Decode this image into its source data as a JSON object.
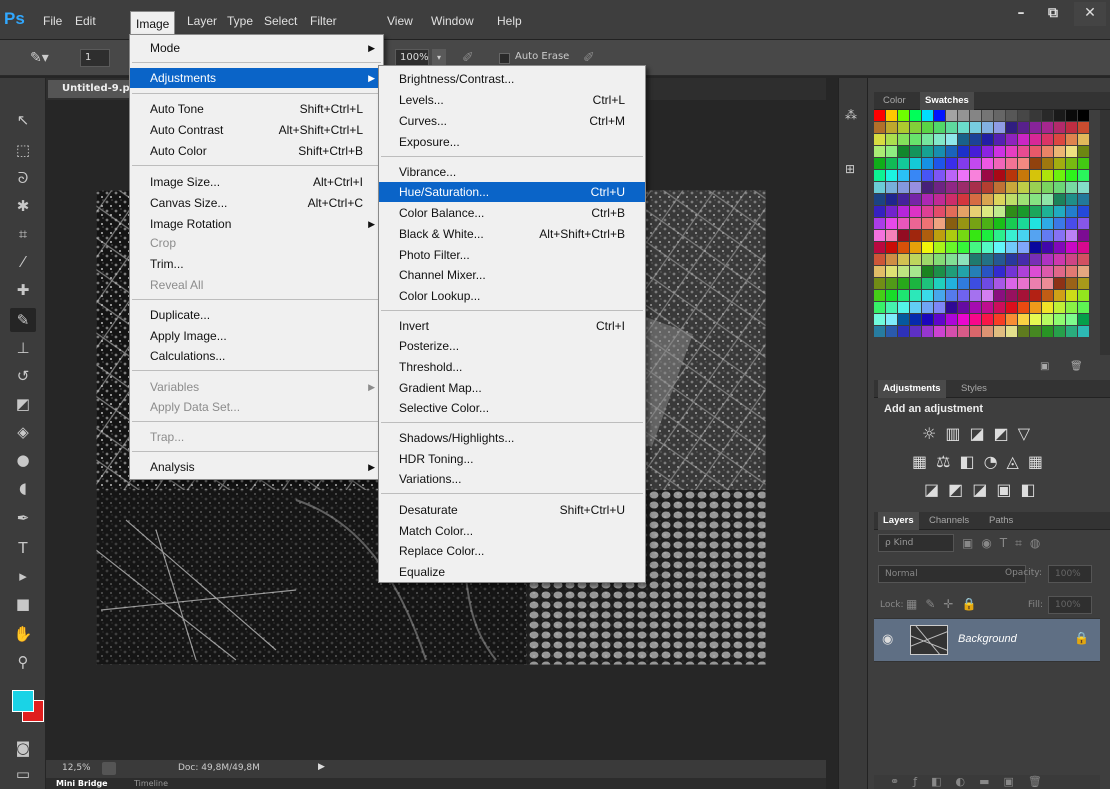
{
  "app": {
    "logo": "Ps"
  },
  "menubar": {
    "items": [
      "File",
      "Edit",
      "Image",
      "Layer",
      "Type",
      "Select",
      "Filter",
      "View",
      "Window",
      "Help"
    ]
  },
  "window_controls": [
    "–",
    "⧉",
    "✕"
  ],
  "options": {
    "brush_size": "1",
    "opacity": "100%",
    "auto_erase": "Auto Erase"
  },
  "document": {
    "tab": "Untitled-9.p",
    "zoom": "12,5%",
    "doc_info": "Doc: 49,8M/49,8M"
  },
  "bottom_tabs": [
    "Mini Bridge",
    "Timeline"
  ],
  "image_menu": {
    "items": [
      {
        "label": "Mode",
        "arrow": true
      },
      {
        "label": "Adjustments",
        "arrow": true,
        "highlight": true
      },
      {
        "label": "Auto Tone",
        "shortcut": "Shift+Ctrl+L"
      },
      {
        "label": "Auto Contrast",
        "shortcut": "Alt+Shift+Ctrl+L"
      },
      {
        "label": "Auto Color",
        "shortcut": "Shift+Ctrl+B"
      },
      {
        "label": "Image Size...",
        "shortcut": "Alt+Ctrl+I"
      },
      {
        "label": "Canvas Size...",
        "shortcut": "Alt+Ctrl+C"
      },
      {
        "label": "Image Rotation",
        "arrow": true
      },
      {
        "label": "Crop",
        "disabled": true
      },
      {
        "label": "Trim..."
      },
      {
        "label": "Reveal All",
        "disabled": true
      },
      {
        "label": "Duplicate..."
      },
      {
        "label": "Apply Image..."
      },
      {
        "label": "Calculations..."
      },
      {
        "label": "Variables",
        "arrow": true,
        "disabled": true
      },
      {
        "label": "Apply Data Set...",
        "disabled": true
      },
      {
        "label": "Trap...",
        "disabled": true
      },
      {
        "label": "Analysis",
        "arrow": true
      }
    ]
  },
  "adjustments_menu": {
    "items": [
      {
        "label": "Brightness/Contrast..."
      },
      {
        "label": "Levels...",
        "shortcut": "Ctrl+L"
      },
      {
        "label": "Curves...",
        "shortcut": "Ctrl+M"
      },
      {
        "label": "Exposure..."
      },
      {
        "label": "Vibrance..."
      },
      {
        "label": "Hue/Saturation...",
        "shortcut": "Ctrl+U",
        "highlight": true
      },
      {
        "label": "Color Balance...",
        "shortcut": "Ctrl+B"
      },
      {
        "label": "Black & White...",
        "shortcut": "Alt+Shift+Ctrl+B"
      },
      {
        "label": "Photo Filter..."
      },
      {
        "label": "Channel Mixer..."
      },
      {
        "label": "Color Lookup..."
      },
      {
        "label": "Invert",
        "shortcut": "Ctrl+I"
      },
      {
        "label": "Posterize..."
      },
      {
        "label": "Threshold..."
      },
      {
        "label": "Gradient Map..."
      },
      {
        "label": "Selective Color..."
      },
      {
        "label": "Shadows/Highlights..."
      },
      {
        "label": "HDR Toning..."
      },
      {
        "label": "Variations..."
      },
      {
        "label": "Desaturate",
        "shortcut": "Shift+Ctrl+U"
      },
      {
        "label": "Match Color..."
      },
      {
        "label": "Replace Color..."
      },
      {
        "label": "Equalize"
      }
    ]
  },
  "panels": {
    "color_tabs": [
      "Color",
      "Swatches"
    ],
    "adj_tabs": [
      "Adjustments",
      "Styles"
    ],
    "adj_title": "Add an adjustment",
    "layers_tabs": [
      "Layers",
      "Channels",
      "Paths"
    ],
    "kind": "ρ Kind",
    "blend": "Normal",
    "opacity_label": "Opacity:",
    "opacity_value": "100%",
    "lock_label": "Lock:",
    "fill_label": "Fill:",
    "fill_value": "100%",
    "layer_name": "Background"
  },
  "colors": {
    "foreground": "#1ad3e6",
    "background": "#e01e1e",
    "highlight": "#0a64c8"
  }
}
